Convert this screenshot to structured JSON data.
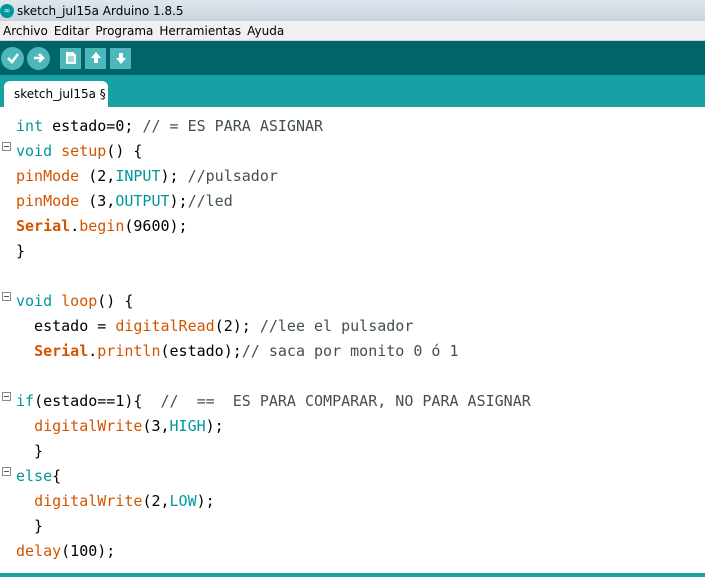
{
  "window": {
    "title": "sketch_jul15a Arduino 1.8.5",
    "icon": "arduino-icon"
  },
  "menu": [
    "Archivo",
    "Editar",
    "Programa",
    "Herramientas",
    "Ayuda"
  ],
  "toolbar": {
    "buttons": [
      "verify-icon",
      "upload-icon",
      "new-icon",
      "open-icon",
      "save-icon"
    ]
  },
  "tabs": [
    {
      "label": "sketch_jul15a §"
    }
  ],
  "colors": {
    "teal_dark": "#006468",
    "teal": "#17a1a5",
    "keyword": "#00979c",
    "function": "#d35400"
  },
  "code": {
    "l1_kw": "int",
    "l1_rest": " estado=0; ",
    "l1_cmt": "// = ES PARA ASIGNAR",
    "l2_kw": "void",
    "l2_fn": "setup",
    "l2_rest": "() {",
    "l3_fn": "pinMode",
    "l3_a": " (2,",
    "l3_c": "INPUT",
    "l3_b": "); ",
    "l3_cmt": "//pulsador",
    "l4_fn": "pinMode",
    "l4_a": " (3,",
    "l4_c": "OUTPUT",
    "l4_b": ");",
    "l4_cmt": "//led",
    "l5_obj": "Serial",
    "l5_dot": ".",
    "l5_fn": "begin",
    "l5_rest": "(9600);",
    "l6": "}",
    "l8_kw": "void",
    "l8_fn": "loop",
    "l8_rest": "() {",
    "l9_a": "  estado = ",
    "l9_fn": "digitalRead",
    "l9_b": "(2); ",
    "l9_cmt": "//lee el pulsador",
    "l10_a": "  ",
    "l10_obj": "Serial",
    "l10_dot": ".",
    "l10_fn": "println",
    "l10_b": "(estado);",
    "l10_cmt": "// saca por monito 0 ó 1",
    "l12_kw": "if",
    "l12_a": "(estado==1){  ",
    "l12_cmt": "//  ==  ES PARA COMPARAR, NO PARA ASIGNAR",
    "l13_a": "  ",
    "l13_fn": "digitalWrite",
    "l13_b": "(3,",
    "l13_c": "HIGH",
    "l13_d": ");",
    "l14": "  }",
    "l15_kw": "else",
    "l15_a": "{",
    "l16_a": "  ",
    "l16_fn": "digitalWrite",
    "l16_b": "(2,",
    "l16_c": "LOW",
    "l16_d": ");",
    "l17": "  }",
    "l18_fn": "delay",
    "l18_a": "(100);"
  }
}
